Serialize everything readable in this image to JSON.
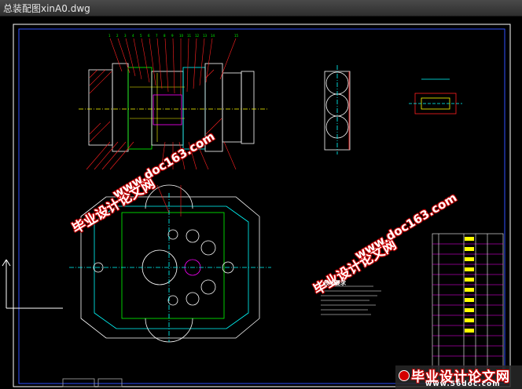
{
  "window": {
    "title": "总装配图xinA0.dwg"
  },
  "watermarks": {
    "cn_text": "毕业设计论文网",
    "url_text": "www.doc163.com"
  },
  "bottom_logo": {
    "cn_text": "毕业设计论文网",
    "url_text": "www.56doc.com"
  },
  "drawing": {
    "notes_title": "技术要求",
    "colors": {
      "border": "#ffffff",
      "frame": "#4060ff",
      "cyan": "#00ffff",
      "green": "#00ff00",
      "red": "#ff2020",
      "yellow": "#ffff00",
      "magenta": "#ff00ff",
      "white": "#ffffff"
    }
  }
}
